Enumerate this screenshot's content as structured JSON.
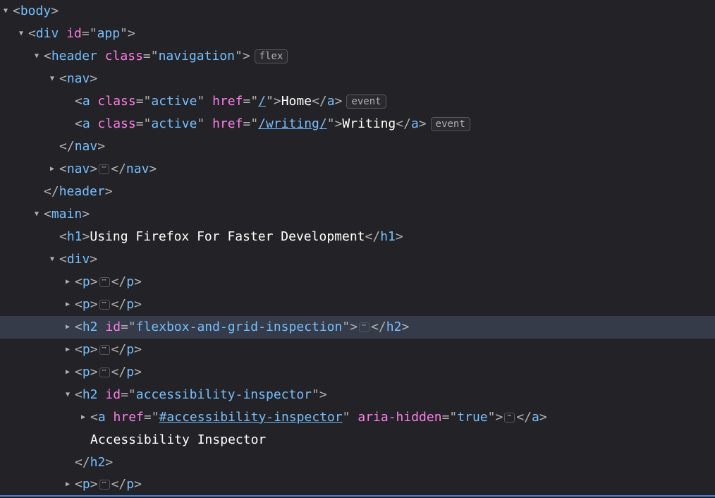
{
  "indentUnit": 22,
  "badges": {
    "flex": "flex",
    "event": "event"
  },
  "ellipsis": "⋯",
  "rows": [
    {
      "depth": 0,
      "twisty": "down",
      "content": [
        {
          "type": "openTag",
          "tag": "body",
          "attrs": []
        }
      ]
    },
    {
      "depth": 1,
      "twisty": "down",
      "content": [
        {
          "type": "openTag",
          "tag": "div",
          "attrs": [
            {
              "name": "id",
              "value": "app"
            }
          ]
        }
      ]
    },
    {
      "depth": 2,
      "twisty": "down",
      "content": [
        {
          "type": "openTag",
          "tag": "header",
          "attrs": [
            {
              "name": "class",
              "value": "navigation"
            }
          ]
        },
        {
          "type": "badge",
          "key": "flex"
        }
      ]
    },
    {
      "depth": 3,
      "twisty": "down",
      "content": [
        {
          "type": "openTag",
          "tag": "nav",
          "attrs": []
        }
      ]
    },
    {
      "depth": 4,
      "twisty": "none",
      "content": [
        {
          "type": "openTag",
          "tag": "a",
          "attrs": [
            {
              "name": "class",
              "value": "active"
            },
            {
              "name": "href",
              "value": "/",
              "underline": true
            }
          ]
        },
        {
          "type": "text",
          "value": "Home"
        },
        {
          "type": "closeTag",
          "tag": "a"
        },
        {
          "type": "badge",
          "key": "event"
        }
      ]
    },
    {
      "depth": 4,
      "twisty": "none",
      "content": [
        {
          "type": "openTag",
          "tag": "a",
          "attrs": [
            {
              "name": "class",
              "value": "active"
            },
            {
              "name": "href",
              "value": "/writing/",
              "underline": true
            }
          ]
        },
        {
          "type": "text",
          "value": "Writing"
        },
        {
          "type": "closeTag",
          "tag": "a"
        },
        {
          "type": "badge",
          "key": "event"
        }
      ]
    },
    {
      "depth": 3,
      "twisty": "none",
      "content": [
        {
          "type": "closeTag",
          "tag": "nav"
        }
      ]
    },
    {
      "depth": 3,
      "twisty": "right",
      "content": [
        {
          "type": "openTag",
          "tag": "nav",
          "attrs": []
        },
        {
          "type": "ellipsis"
        },
        {
          "type": "closeTag",
          "tag": "nav"
        }
      ]
    },
    {
      "depth": 2,
      "twisty": "none",
      "content": [
        {
          "type": "closeTag",
          "tag": "header"
        }
      ]
    },
    {
      "depth": 2,
      "twisty": "down",
      "content": [
        {
          "type": "openTag",
          "tag": "main",
          "attrs": []
        }
      ]
    },
    {
      "depth": 3,
      "twisty": "none",
      "content": [
        {
          "type": "openTag",
          "tag": "h1",
          "attrs": []
        },
        {
          "type": "text",
          "value": "Using Firefox For Faster Development"
        },
        {
          "type": "closeTag",
          "tag": "h1"
        }
      ]
    },
    {
      "depth": 3,
      "twisty": "down",
      "content": [
        {
          "type": "openTag",
          "tag": "div",
          "attrs": []
        }
      ]
    },
    {
      "depth": 4,
      "twisty": "right",
      "content": [
        {
          "type": "openTag",
          "tag": "p",
          "attrs": []
        },
        {
          "type": "ellipsis"
        },
        {
          "type": "closeTag",
          "tag": "p"
        }
      ]
    },
    {
      "depth": 4,
      "twisty": "right",
      "content": [
        {
          "type": "openTag",
          "tag": "p",
          "attrs": []
        },
        {
          "type": "ellipsis"
        },
        {
          "type": "closeTag",
          "tag": "p"
        }
      ]
    },
    {
      "depth": 4,
      "twisty": "right",
      "highlighted": true,
      "content": [
        {
          "type": "openTag",
          "tag": "h2",
          "attrs": [
            {
              "name": "id",
              "value": "flexbox-and-grid-inspection"
            }
          ]
        },
        {
          "type": "ellipsis"
        },
        {
          "type": "closeTag",
          "tag": "h2"
        }
      ]
    },
    {
      "depth": 4,
      "twisty": "right",
      "content": [
        {
          "type": "openTag",
          "tag": "p",
          "attrs": []
        },
        {
          "type": "ellipsis"
        },
        {
          "type": "closeTag",
          "tag": "p"
        }
      ]
    },
    {
      "depth": 4,
      "twisty": "right",
      "content": [
        {
          "type": "openTag",
          "tag": "p",
          "attrs": []
        },
        {
          "type": "ellipsis"
        },
        {
          "type": "closeTag",
          "tag": "p"
        }
      ]
    },
    {
      "depth": 4,
      "twisty": "down",
      "content": [
        {
          "type": "openTag",
          "tag": "h2",
          "attrs": [
            {
              "name": "id",
              "value": "accessibility-inspector"
            }
          ]
        }
      ]
    },
    {
      "depth": 5,
      "twisty": "right",
      "content": [
        {
          "type": "openTag",
          "tag": "a",
          "attrs": [
            {
              "name": "href",
              "value": "#accessibility-inspector",
              "underline": true
            },
            {
              "name": "aria-hidden",
              "value": "true"
            }
          ]
        },
        {
          "type": "ellipsis"
        },
        {
          "type": "closeTag",
          "tag": "a"
        }
      ]
    },
    {
      "depth": 5,
      "twisty": "none",
      "content": [
        {
          "type": "text",
          "value": "Accessibility Inspector"
        }
      ]
    },
    {
      "depth": 4,
      "twisty": "none",
      "content": [
        {
          "type": "closeTag",
          "tag": "h2"
        }
      ]
    },
    {
      "depth": 4,
      "twisty": "right",
      "bottomEdge": true,
      "content": [
        {
          "type": "openTag",
          "tag": "p",
          "attrs": []
        },
        {
          "type": "ellipsis"
        },
        {
          "type": "closeTag",
          "tag": "p"
        }
      ]
    }
  ]
}
